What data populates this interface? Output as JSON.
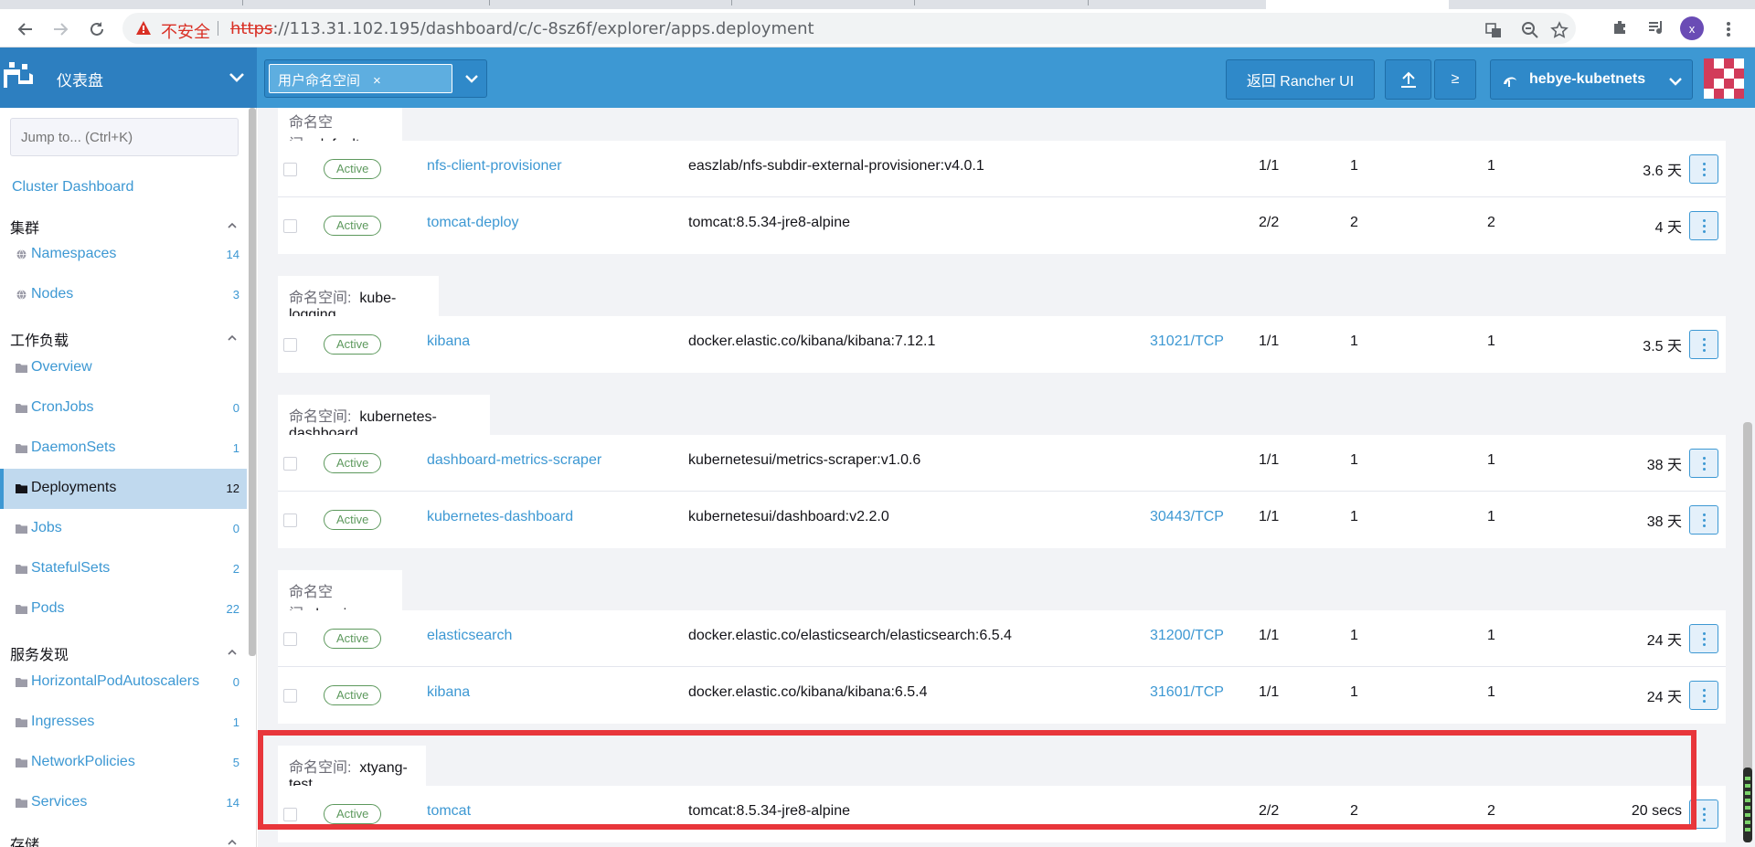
{
  "browser": {
    "insecure_label": "不安全",
    "url_scheme": "https",
    "url_rest": "://113.31.102.195/dashboard/c/c-8sz6f/explorer/apps.deployment",
    "profile_initial": "x"
  },
  "header": {
    "brand_title": "仪表盘",
    "namespace_chip": "用户命名空间",
    "namespace_chip_remove": "×",
    "back_button": "返回 Rancher UI",
    "shell_glyph": "≥",
    "cluster_name": "hebye-kubetnets",
    "accent_color": "#3d98d3",
    "brand_color": "#2d7fc0"
  },
  "sidebar": {
    "search_placeholder": "Jump to... (Ctrl+K)",
    "cluster_dashboard": "Cluster Dashboard",
    "groups": [
      {
        "title": "集群",
        "items": [
          {
            "label": "Namespaces",
            "count": "14",
            "icon": "globe-icon"
          },
          {
            "label": "Nodes",
            "count": "3",
            "icon": "globe-icon"
          }
        ]
      },
      {
        "title": "工作负载",
        "items": [
          {
            "label": "Overview",
            "count": "",
            "icon": "folder-icon"
          },
          {
            "label": "CronJobs",
            "count": "0",
            "icon": "folder-icon"
          },
          {
            "label": "DaemonSets",
            "count": "1",
            "icon": "folder-icon"
          },
          {
            "label": "Deployments",
            "count": "12",
            "icon": "folder-icon",
            "active": true
          },
          {
            "label": "Jobs",
            "count": "0",
            "icon": "folder-icon"
          },
          {
            "label": "StatefulSets",
            "count": "2",
            "icon": "folder-icon"
          },
          {
            "label": "Pods",
            "count": "22",
            "icon": "folder-icon"
          }
        ]
      },
      {
        "title": "服务发现",
        "items": [
          {
            "label": "HorizontalPodAutoscalers",
            "count": "0",
            "icon": "folder-icon"
          },
          {
            "label": "Ingresses",
            "count": "1",
            "icon": "folder-icon"
          },
          {
            "label": "NetworkPolicies",
            "count": "5",
            "icon": "folder-icon"
          },
          {
            "label": "Services",
            "count": "14",
            "icon": "folder-icon"
          }
        ]
      },
      {
        "title": "存储",
        "items": []
      }
    ]
  },
  "table": {
    "namespace_prefix": "命名空间:",
    "status_active_color": "#5d995d",
    "groups": [
      {
        "namespace": "default",
        "rows": [
          {
            "status": "Active",
            "name": "nfs-client-provisioner",
            "image": "easzlab/nfs-subdir-external-provisioner:v4.0.1",
            "port": "",
            "ready": "1/1",
            "up_to_date": "1",
            "available": "1",
            "age": "3.6 天"
          },
          {
            "status": "Active",
            "name": "tomcat-deploy",
            "image": "tomcat:8.5.34-jre8-alpine",
            "port": "",
            "ready": "2/2",
            "up_to_date": "2",
            "available": "2",
            "age": "4 天"
          }
        ]
      },
      {
        "namespace": "kube-logging",
        "rows": [
          {
            "status": "Active",
            "name": "kibana",
            "image": "docker.elastic.co/kibana/kibana:7.12.1",
            "port": "31021/TCP",
            "ready": "1/1",
            "up_to_date": "1",
            "available": "1",
            "age": "3.5 天"
          }
        ]
      },
      {
        "namespace": "kubernetes-dashboard",
        "rows": [
          {
            "status": "Active",
            "name": "dashboard-metrics-scraper",
            "image": "kubernetesui/metrics-scraper:v1.0.6",
            "port": "",
            "ready": "1/1",
            "up_to_date": "1",
            "available": "1",
            "age": "38 天"
          },
          {
            "status": "Active",
            "name": "kubernetes-dashboard",
            "image": "kubernetesui/dashboard:v2.2.0",
            "port": "30443/TCP",
            "ready": "1/1",
            "up_to_date": "1",
            "available": "1",
            "age": "38 天"
          }
        ]
      },
      {
        "namespace": "logging",
        "rows": [
          {
            "status": "Active",
            "name": "elasticsearch",
            "image": "docker.elastic.co/elasticsearch/elasticsearch:6.5.4",
            "port": "31200/TCP",
            "ready": "1/1",
            "up_to_date": "1",
            "available": "1",
            "age": "24 天"
          },
          {
            "status": "Active",
            "name": "kibana",
            "image": "docker.elastic.co/kibana/kibana:6.5.4",
            "port": "31601/TCP",
            "ready": "1/1",
            "up_to_date": "1",
            "available": "1",
            "age": "24 天"
          }
        ]
      },
      {
        "namespace": "xtyang-test",
        "rows": [
          {
            "status": "Active",
            "name": "tomcat",
            "image": "tomcat:8.5.34-jre8-alpine",
            "port": "",
            "ready": "2/2",
            "up_to_date": "2",
            "available": "2",
            "age": "20 secs"
          }
        ]
      }
    ]
  },
  "annotation": {
    "highlight_color": "#e8363b"
  }
}
